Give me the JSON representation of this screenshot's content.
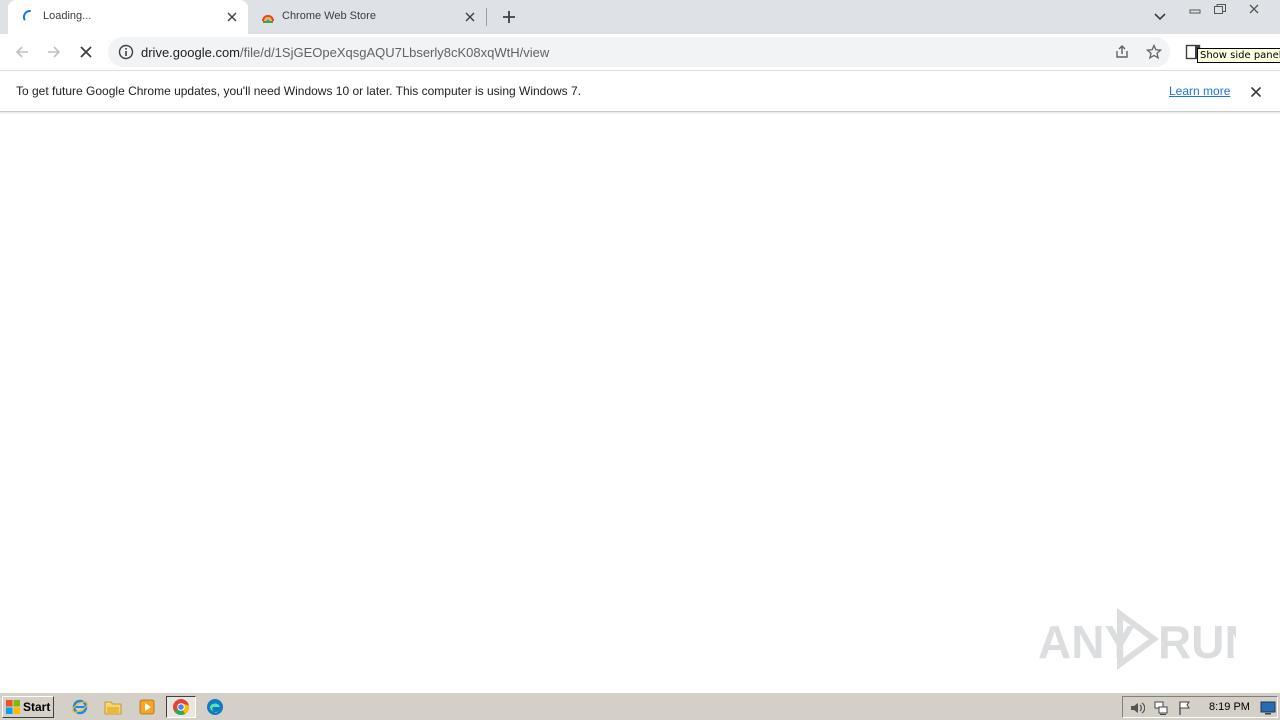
{
  "window": {
    "tabs": [
      {
        "title": "Loading...",
        "favicon": "loading-spinner-icon",
        "active": true
      },
      {
        "title": "Chrome Web Store",
        "favicon": "chrome-web-store-icon",
        "active": false
      }
    ],
    "controls": [
      "minimize-icon",
      "restore-icon",
      "close-icon"
    ]
  },
  "toolbar": {
    "url_host": "drive.google.com",
    "url_path": "/file/d/1SjGEOpeXqsgAQU7Lbserly8cK08xqWtH/view",
    "tooltip": "Show side panel"
  },
  "infobar": {
    "message": "To get future Google Chrome updates, you'll need Windows 10 or later. This computer is using Windows 7.",
    "link": "Learn more"
  },
  "watermark": {
    "text": "ANY RUN"
  },
  "taskbar": {
    "start_label": "Start",
    "clock": "8:19 PM"
  },
  "colors": {
    "tabstrip": "#dee1e6",
    "omnibox": "#f1f3f4",
    "link": "#1a73e8",
    "taskbar": "#d4d0c8"
  }
}
